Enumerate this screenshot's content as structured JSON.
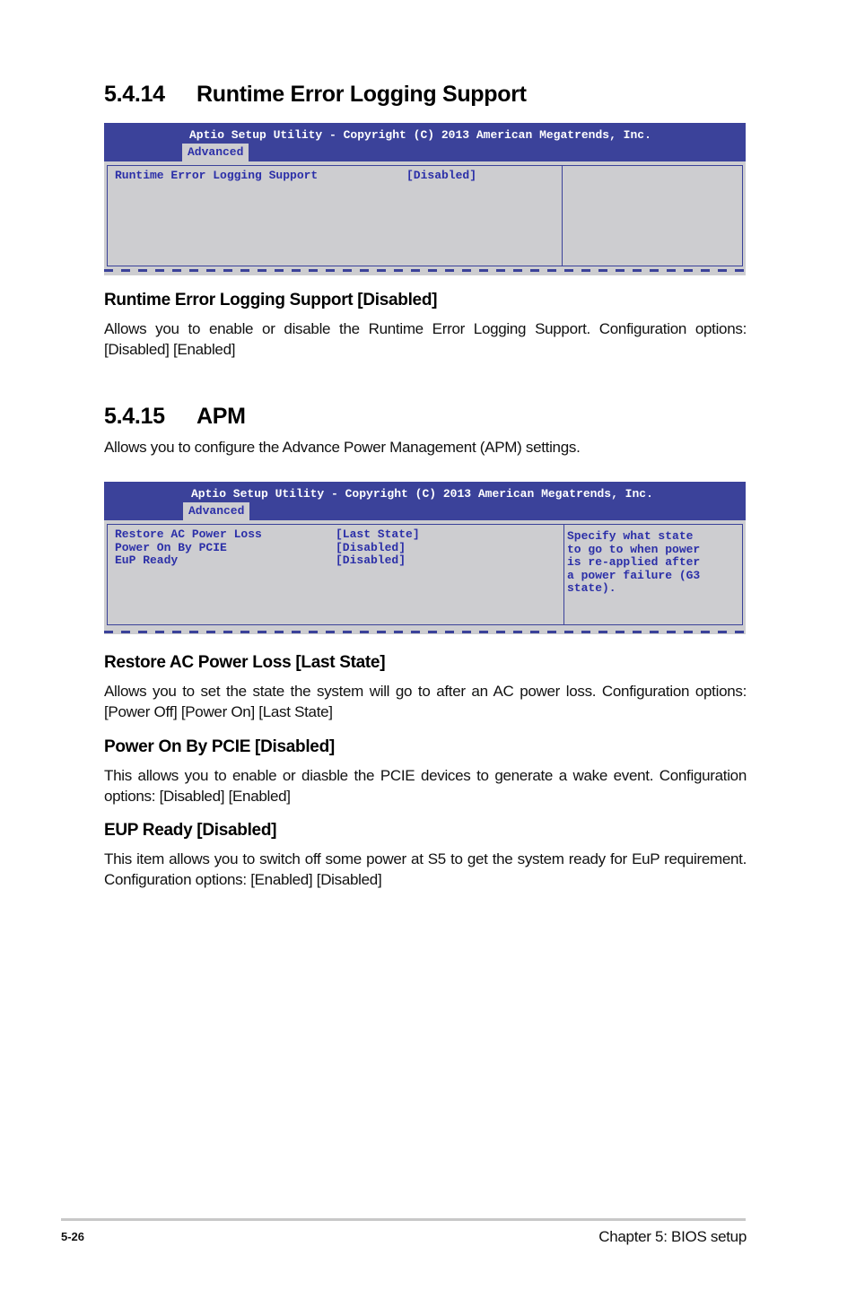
{
  "section_14": {
    "number": "5.4.14",
    "title": "Runtime Error Logging Support",
    "bios": {
      "title_bar": "Aptio Setup Utility - Copyright (C) 2013 American Megatrends, Inc.",
      "tab": "Advanced",
      "items": [
        {
          "label": "Runtime Error Logging Support",
          "value": "[Disabled]"
        }
      ],
      "help_text": ""
    },
    "options": [
      {
        "heading": "Runtime Error Logging Support [Disabled]",
        "description": "Allows you to enable or disable the Runtime Error Logging Support. Configuration options: [Disabled] [Enabled]"
      }
    ]
  },
  "section_15": {
    "number": "5.4.15",
    "title": "APM",
    "intro": "Allows you to configure the Advance Power Management (APM) settings.",
    "bios": {
      "title_bar": "Aptio Setup Utility - Copyright (C) 2013 American Megatrends, Inc.",
      "tab": "Advanced",
      "items": [
        {
          "label": "Restore AC Power Loss",
          "value": "[Last State]"
        },
        {
          "label": "Power On By PCIE",
          "value": "[Disabled]"
        },
        {
          "label": "EuP Ready",
          "value": "[Disabled]"
        }
      ],
      "help_text": "Specify what state\nto go to when power\nis re-applied after\na power failure (G3\nstate)."
    },
    "options": [
      {
        "heading": "Restore AC Power Loss [Last State]",
        "description": "Allows you to set the state the system will go to after an AC power loss. Configuration options: [Power Off] [Power On] [Last State]"
      },
      {
        "heading": "Power On By PCIE [Disabled]",
        "description": "This allows you to enable or diasble the PCIE devices to generate a wake event. Configuration options: [Disabled] [Enabled]"
      },
      {
        "heading": "EUP Ready [Disabled]",
        "description": "This item allows you to switch off some power at S5 to get the system ready for EuP requirement. Configuration options: [Enabled] [Disabled]"
      }
    ]
  },
  "footer": {
    "page_number": "5-26",
    "chapter": "Chapter 5: BIOS setup"
  },
  "colors": {
    "bios_header": "#3b429a",
    "bios_body": "#cdcdd0",
    "bios_text": "#2b2fa8"
  }
}
